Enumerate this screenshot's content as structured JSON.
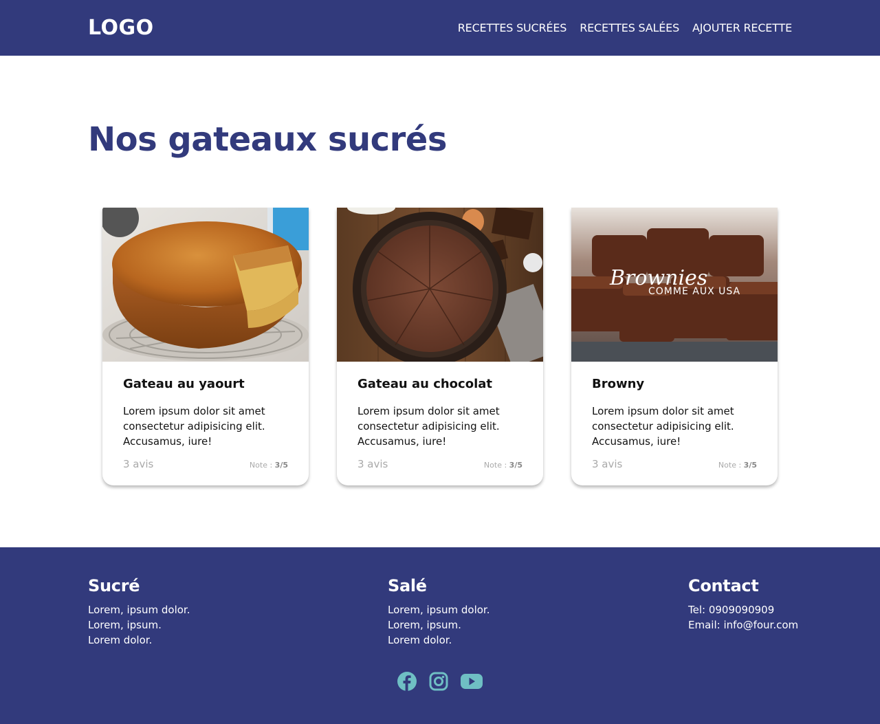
{
  "header": {
    "logo": "LOGO",
    "nav": [
      "RECETTES SUCRÉES",
      "RECETTES SALÉES",
      "AJOUTER RECETTE"
    ]
  },
  "main": {
    "title": "Nos gateaux sucrés",
    "cards": [
      {
        "title": "Gateau au yaourt",
        "description": "Lorem ipsum dolor sit amet consectetur adipisicing elit. Accusamus, iure!",
        "reviews": "3 avis",
        "note_label": "Note : ",
        "note_value": "3/5",
        "image": "yogurt-cake-photo"
      },
      {
        "title": "Gateau au chocolat",
        "description": "Lorem ipsum dolor sit amet consectetur adipisicing elit. Accusamus, iure!",
        "reviews": "3 avis",
        "note_label": "Note : ",
        "note_value": "3/5",
        "image": "chocolate-cake-photo"
      },
      {
        "title": "Browny",
        "description": "Lorem ipsum dolor sit amet consectetur adipisicing elit. Accusamus, iure!",
        "reviews": "3 avis",
        "note_label": "Note : ",
        "note_value": "3/5",
        "image": "brownies-photo",
        "image_text": {
          "script": "Brownies",
          "caption": "COMME AUX USA"
        }
      }
    ]
  },
  "footer": {
    "sweet": {
      "title": "Sucré",
      "lines": [
        "Lorem, ipsum dolor.",
        "Lorem, ipsum.",
        "Lorem dolor."
      ]
    },
    "savory": {
      "title": "Salé",
      "lines": [
        "Lorem, ipsum dolor.",
        "Lorem, ipsum.",
        "Lorem dolor."
      ]
    },
    "contact": {
      "title": "Contact",
      "lines": [
        "Tel: 0909090909",
        "Email: info@four.com"
      ]
    },
    "socials": [
      "facebook-icon",
      "instagram-icon",
      "youtube-icon"
    ]
  },
  "colors": {
    "primary": "#323a7c",
    "social_icon": "#6fbfc4",
    "muted_text": "#a9a9a9"
  }
}
